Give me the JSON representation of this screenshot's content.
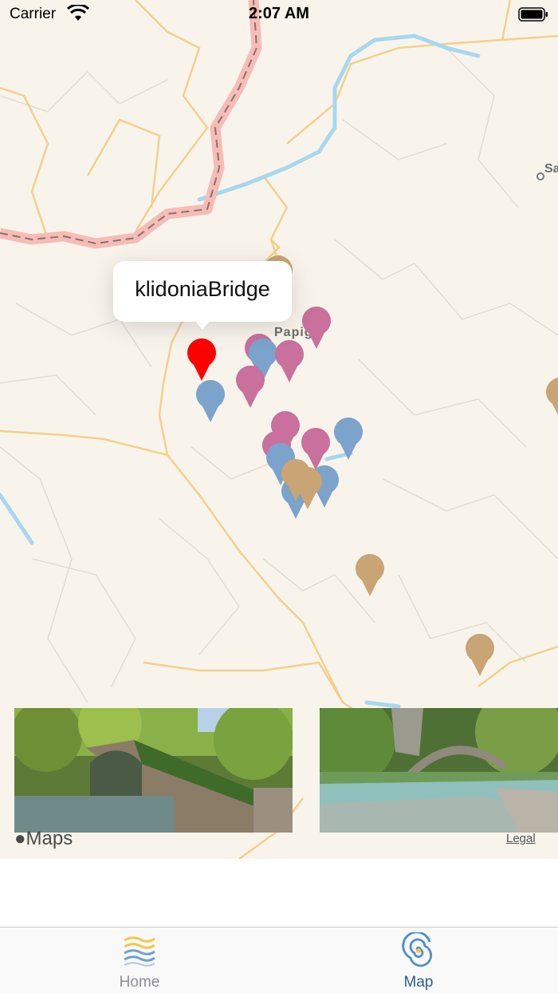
{
  "status_bar": {
    "carrier": "Carrier",
    "time": "2:07 AM",
    "icons": [
      "wifi-icon",
      "battery-icon"
    ]
  },
  "map": {
    "place_label": "Papigo",
    "place_label_partial": "Sa",
    "callout": {
      "title": "klidoniaBridge"
    },
    "attribution": {
      "maps_logo": "Maps",
      "legal": "Legal"
    },
    "pin_colors": {
      "selected": "#ff0000",
      "pink": "#c9709c",
      "blue": "#7ba3cc",
      "tan": "#c9a474"
    }
  },
  "carousel": {
    "cards": [
      {
        "name": "stone bridge over river, green forest"
      },
      {
        "name": "arched stone bridge over turquoise river"
      }
    ]
  },
  "tab_bar": {
    "tabs": [
      {
        "label": "Home",
        "icon": "waves-icon",
        "selected": false
      },
      {
        "label": "Map",
        "icon": "spiral-icon",
        "selected": true
      }
    ],
    "colors": {
      "selected": "#2f5f8c",
      "unselected": "#8e8e93"
    }
  }
}
